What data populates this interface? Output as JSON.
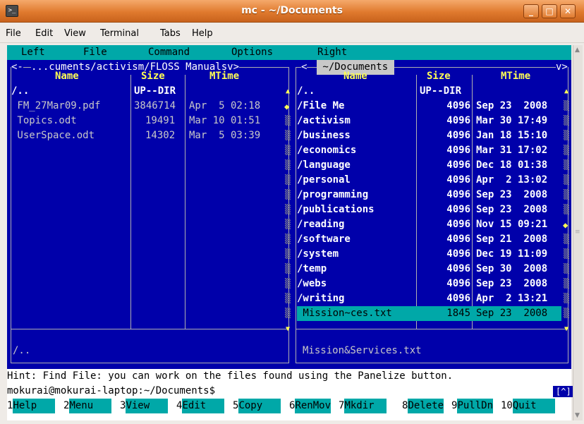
{
  "window": {
    "title": "mc - ~/Documents",
    "icon": "terminal-icon",
    "controls": {
      "minimize": "_",
      "maximize": "□",
      "close": "✕"
    }
  },
  "menubar": [
    "File",
    "Edit",
    "View",
    "Terminal",
    "Tabs",
    "Help"
  ],
  "mc_menu": [
    "Left",
    "File",
    "Command",
    "Options",
    "Right"
  ],
  "left_panel": {
    "path": "...cuments/activism/FLOSS Manualsv>",
    "left_marker": "<-",
    "headers": {
      "name": "Name",
      "size": "Size",
      "mtime": "MTime"
    },
    "rows": [
      {
        "name": "/..",
        "size": "UP--DIR",
        "mtime": "",
        "type": "updir"
      },
      {
        "name": " FM_27Mar09.pdf",
        "size": "3846714",
        "mtime": "Apr  5 02:18",
        "type": "file"
      },
      {
        "name": " Topics.odt",
        "size": "19491",
        "mtime": "Mar 10 01:51",
        "type": "file"
      },
      {
        "name": " UserSpace.odt",
        "size": "14302",
        "mtime": "Mar  5 03:39",
        "type": "file"
      }
    ],
    "status": "/.."
  },
  "right_panel": {
    "path": " ~/Documents ",
    "left_marker": "<",
    "right_marker": "v>",
    "headers": {
      "name": "Name",
      "size": "Size",
      "mtime": "MTime"
    },
    "rows": [
      {
        "name": "/..",
        "size": "UP--DIR",
        "mtime": "",
        "type": "updir"
      },
      {
        "name": "/File Me",
        "size": "4096",
        "mtime": "Sep 23  2008",
        "type": "dir"
      },
      {
        "name": "/activism",
        "size": "4096",
        "mtime": "Mar 30 17:49",
        "type": "dir"
      },
      {
        "name": "/business",
        "size": "4096",
        "mtime": "Jan 18 15:10",
        "type": "dir"
      },
      {
        "name": "/economics",
        "size": "4096",
        "mtime": "Mar 31 17:02",
        "type": "dir"
      },
      {
        "name": "/language",
        "size": "4096",
        "mtime": "Dec 18 01:38",
        "type": "dir"
      },
      {
        "name": "/personal",
        "size": "4096",
        "mtime": "Apr  2 13:02",
        "type": "dir"
      },
      {
        "name": "/programming",
        "size": "4096",
        "mtime": "Sep 23  2008",
        "type": "dir"
      },
      {
        "name": "/publications",
        "size": "4096",
        "mtime": "Sep 23  2008",
        "type": "dir"
      },
      {
        "name": "/reading",
        "size": "4096",
        "mtime": "Nov 15 09:21",
        "type": "dir"
      },
      {
        "name": "/software",
        "size": "4096",
        "mtime": "Sep 21  2008",
        "type": "dir"
      },
      {
        "name": "/system",
        "size": "4096",
        "mtime": "Dec 19 11:09",
        "type": "dir"
      },
      {
        "name": "/temp",
        "size": "4096",
        "mtime": "Sep 30  2008",
        "type": "dir"
      },
      {
        "name": "/webs",
        "size": "4096",
        "mtime": "Sep 23  2008",
        "type": "dir"
      },
      {
        "name": "/writing",
        "size": "4096",
        "mtime": "Apr  2 13:21",
        "type": "dir"
      },
      {
        "name": " Mission~ces.txt",
        "size": "1845",
        "mtime": "Sep 23  2008",
        "type": "selected"
      }
    ],
    "status": "Mission&Services.txt"
  },
  "hint": "Hint: Find File: you can work on the files found using the Panelize button.",
  "prompt": "mokurai@mokurai-laptop:~/Documents$",
  "corner_indicator": "[^]",
  "fkeys": [
    {
      "num": "1",
      "label": "Help"
    },
    {
      "num": "2",
      "label": "Menu"
    },
    {
      "num": "3",
      "label": "View"
    },
    {
      "num": "4",
      "label": "Edit"
    },
    {
      "num": "5",
      "label": "Copy"
    },
    {
      "num": "6",
      "label": "RenMov"
    },
    {
      "num": "7",
      "label": "Mkdir"
    },
    {
      "num": "8",
      "label": "Delete"
    },
    {
      "num": "9",
      "label": "PullDn"
    },
    {
      "num": "10",
      "label": "Quit"
    }
  ],
  "colors": {
    "panel_bg": "#0000aa",
    "accent_cyan": "#00a8a8",
    "header_yellow": "#ffff55",
    "titlebar_orange": "#e07a2e"
  }
}
